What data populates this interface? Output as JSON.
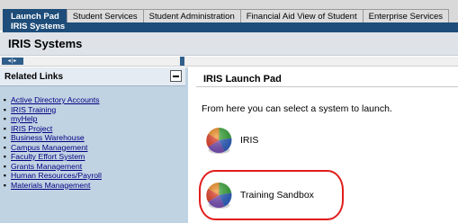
{
  "tabs": [
    {
      "label": "Launch Pad",
      "active": true
    },
    {
      "label": "Student Services",
      "active": false
    },
    {
      "label": "Student Administration",
      "active": false
    },
    {
      "label": "Financial Aid View of Student",
      "active": false
    },
    {
      "label": "Enterprise Services",
      "active": false
    }
  ],
  "subtab": {
    "label": "IRIS Systems"
  },
  "page_title": "IRIS Systems",
  "related_links": {
    "header": "Related Links",
    "items": [
      "Active Directory Accounts",
      "IRIS Training",
      "myHelp",
      "IRIS Project",
      "Business Warehouse",
      "Campus Management",
      "Faculty Effort System",
      "Grants Management",
      "Human Resources/Payroll",
      "Materials Management"
    ]
  },
  "launch_pad": {
    "title": "IRIS Launch Pad",
    "intro": "From here you can select a system to launch.",
    "systems": [
      {
        "label": "IRIS",
        "icon": "iris-logo-icon"
      },
      {
        "label": "Training Sandbox",
        "icon": "iris-logo-icon"
      }
    ]
  },
  "colors": {
    "tab_active": "#1e4d7a",
    "sidebar_bg": "#c0d3e3",
    "link": "#000080",
    "highlight": "#e21c1c"
  }
}
